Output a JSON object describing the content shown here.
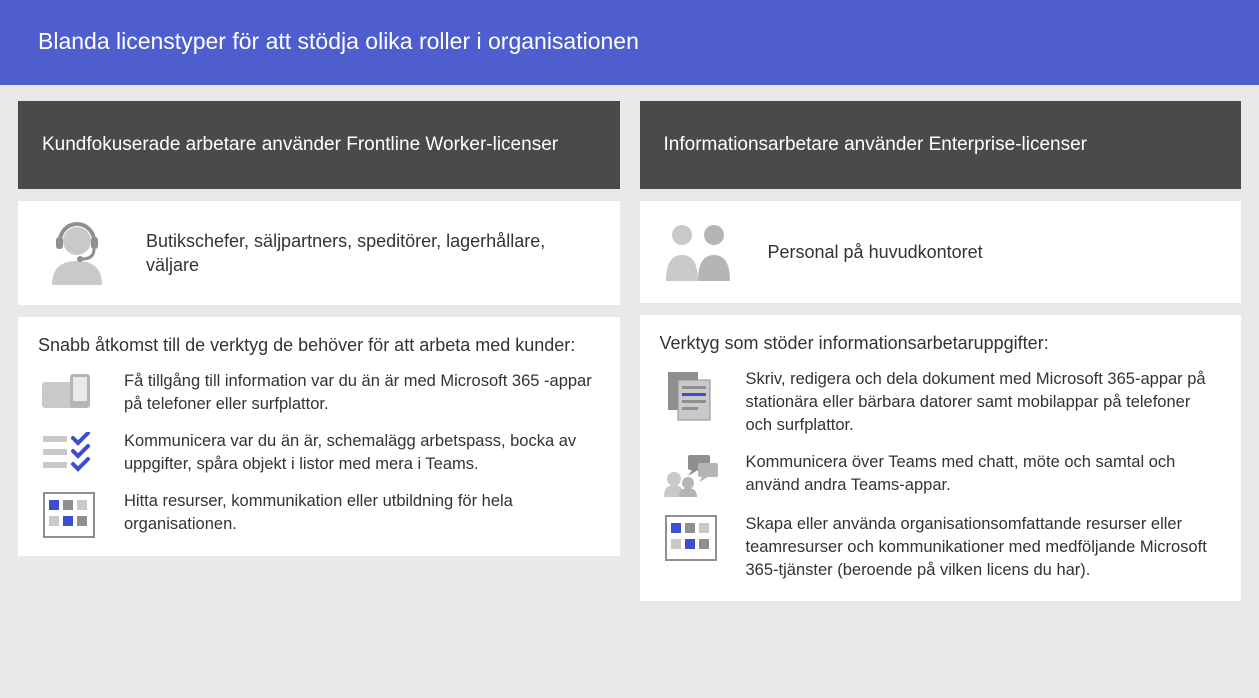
{
  "banner": "Blanda licenstyper för att stödja olika roller i organisationen",
  "left": {
    "title": "Kundfokuserade arbetare använder Frontline Worker-licenser",
    "persona": "Butikschefer, säljpartners, speditörer, lagerhållare, väljare",
    "lead": "Snabb åtkomst till de verktyg de behöver för att arbeta med kunder:",
    "f1": "Få tillgång till information var du än är med Microsoft 365 -appar på telefoner eller surfplattor.",
    "f2": "Kommunicera var du än är, schemalägg arbetspass, bocka av uppgifter, spåra objekt i listor med mera i Teams.",
    "f3": "Hitta resurser, kommunikation eller utbildning för hela organisationen."
  },
  "right": {
    "title": "Informationsarbetare använder Enterprise-licenser",
    "persona": "Personal på huvudkontoret",
    "lead": "Verktyg som stöder informationsarbetaruppgifter:",
    "f1": "Skriv, redigera och dela dokument med Microsoft 365-appar på stationära eller bärbara datorer samt mobilappar på telefoner och surfplattor.",
    "f2": "Kommunicera över Teams med chatt, möte och samtal och använd andra Teams-appar.",
    "f3": "Skapa eller använda organisationsomfattande resurser eller teamresurser och kommunikationer med medföljande Microsoft 365-tjänster (beroende på vilken licens du har)."
  }
}
